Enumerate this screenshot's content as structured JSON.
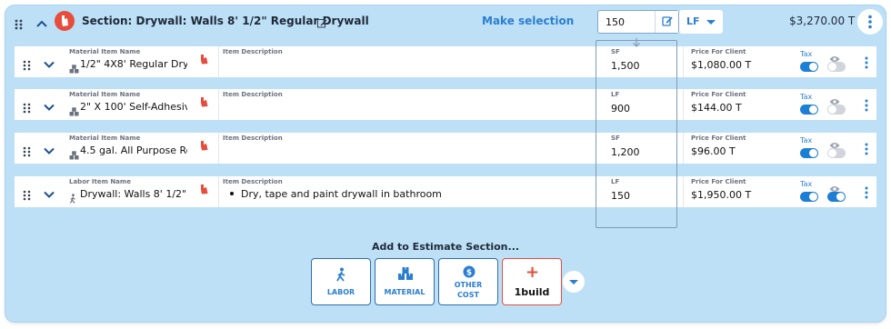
{
  "section": {
    "title": "Section: Drywall: Walls 8' 1/2\" Regular Drywall",
    "make_selection": "Make selection",
    "quantity": "150",
    "unit": "LF",
    "total": "$3,270.00 T"
  },
  "rows": [
    {
      "type_label": "Material Item Name",
      "name": "1/2\" 4X8' Regular Dry",
      "desc_label": "Item Description",
      "description": "",
      "unit": "SF",
      "qty": "1,500",
      "price_label": "Price For Client",
      "price": "$1,080.00 T",
      "tax_label": "Tax",
      "tax_on": true,
      "visible_on": false
    },
    {
      "type_label": "Material Item Name",
      "name": "2\" X 100' Self-Adhesiv",
      "desc_label": "Item Description",
      "description": "",
      "unit": "LF",
      "qty": "900",
      "price_label": "Price For Client",
      "price": "$144.00 T",
      "tax_label": "Tax",
      "tax_on": true,
      "visible_on": false
    },
    {
      "type_label": "Material Item Name",
      "name": "4.5 gal. All Purpose Re",
      "desc_label": "Item Description",
      "description": "",
      "unit": "SF",
      "qty": "1,200",
      "price_label": "Price For Client",
      "price": "$96.00 T",
      "tax_label": "Tax",
      "tax_on": true,
      "visible_on": false
    },
    {
      "type_label": "Labor Item Name",
      "name": "Drywall: Walls 8' 1/2\"",
      "desc_label": "Item Description",
      "description": "Dry, tape and paint drywall in bathroom",
      "unit": "LF",
      "qty": "150",
      "price_label": "Price For Client",
      "price": "$1,950.00 T",
      "tax_label": "Tax",
      "tax_on": true,
      "visible_on": true
    }
  ],
  "add_section": {
    "title": "Add to Estimate Section...",
    "buttons": [
      "LABOR",
      "MATERIAL",
      "OTHER COST",
      "1build"
    ]
  },
  "icons": [
    "drag-handle-icon",
    "chevron-up-icon",
    "chevron-down-icon",
    "edit-icon",
    "labor-icon",
    "material-icon",
    "dollar-icon",
    "plus-icon",
    "eye-icon",
    "kebab-icon",
    "arrow-down-icon"
  ],
  "colors": {
    "panel_bg": "#bde0f7",
    "accent_blue": "#2a7fd1",
    "brand_red": "#e74c3c"
  }
}
